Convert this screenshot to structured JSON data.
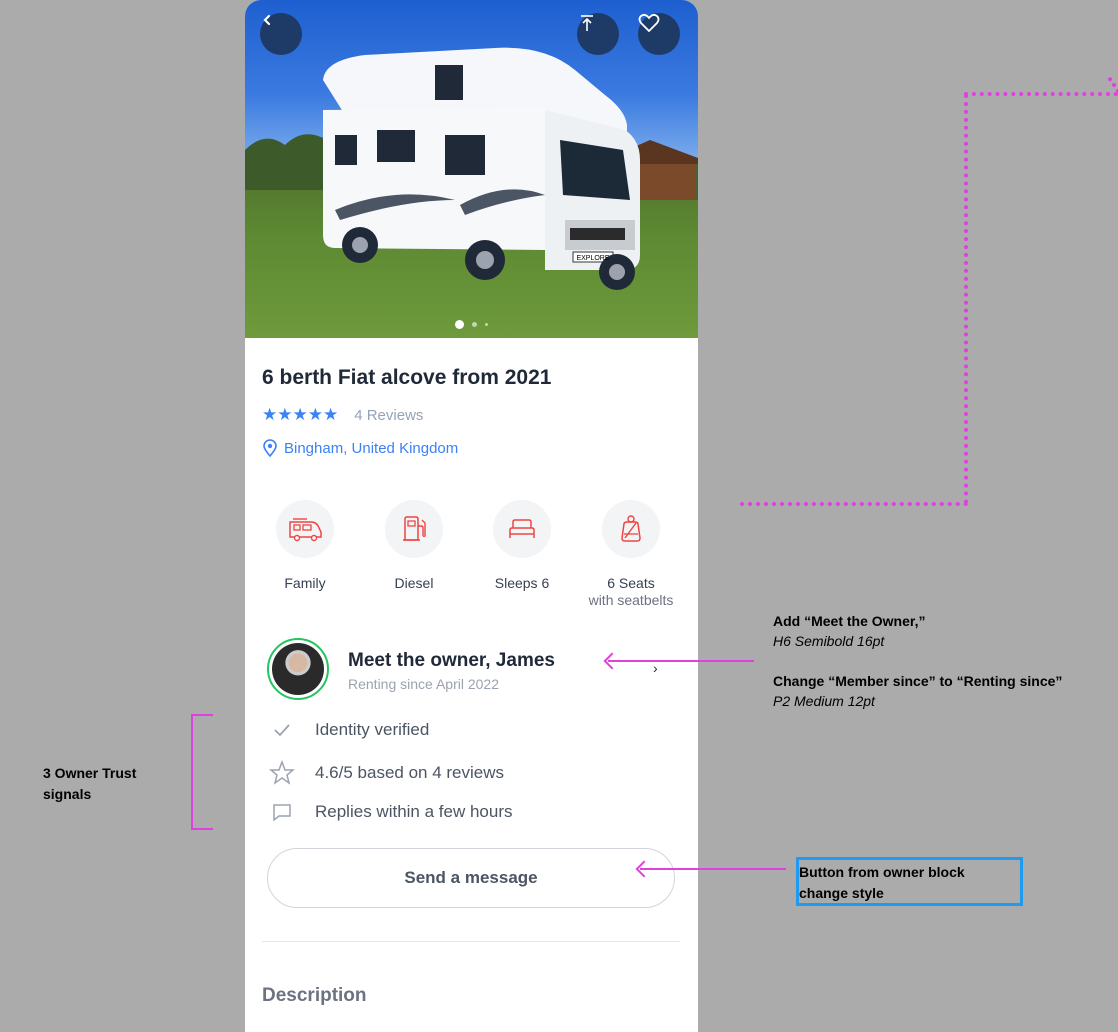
{
  "listing": {
    "title": "6 berth Fiat alcove from 2021",
    "stars": "★★★★★",
    "reviews": "4 Reviews",
    "location": "Bingham, United Kingdom",
    "plate": "EXPLORE"
  },
  "hero": {
    "back_icon": "chevron-left-icon",
    "share_icon": "share-upload-icon",
    "favorite_icon": "heart-icon",
    "carousel_active_index": 1,
    "carousel_count": 3
  },
  "features": [
    {
      "icon": "campervan-icon",
      "label": "Family",
      "sub": ""
    },
    {
      "icon": "fuel-pump-icon",
      "label": "Diesel",
      "sub": ""
    },
    {
      "icon": "bed-icon",
      "label": "Sleeps 6",
      "sub": ""
    },
    {
      "icon": "seatbelt-icon",
      "label": "6 Seats",
      "sub": "with seatbelts"
    }
  ],
  "owner": {
    "name": "Meet the owner, James",
    "since": "Renting since April 2022",
    "chevron": "›"
  },
  "trust": [
    {
      "icon": "check-icon",
      "text": "Identity verified"
    },
    {
      "icon": "star-outline-icon",
      "text": "4.6/5 based on 4 reviews"
    },
    {
      "icon": "chat-bubble-icon",
      "text": "Replies within a few hours"
    }
  ],
  "message_button": "Send a message",
  "description_title": "Description",
  "annotations": {
    "trust_label_1": "3 Owner Trust",
    "trust_label_2": "signals",
    "owner_note_title": "Add “Meet the Owner,”",
    "owner_note_style": "H6 Semibold 16pt",
    "since_note_title": "Change “Member since” to “Renting since”",
    "since_note_style": "P2 Medium 12pt",
    "button_note_1": "Button from owner block",
    "button_note_2": "change style"
  },
  "colors": {
    "accent_blue": "#3b82f6",
    "annotation_magenta": "#e040e0",
    "annotation_blue": "#1e9bf0",
    "feature_icon_red": "#ef4444",
    "avatar_ring_green": "#22c55e"
  }
}
